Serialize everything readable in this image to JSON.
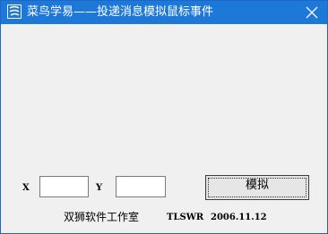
{
  "window": {
    "title": "菜鸟学易——投递消息模拟鼠标事件",
    "title_color": "#1e78d7",
    "icon": "app-logo-icon",
    "close_icon": "close-icon"
  },
  "form": {
    "x_label": "X",
    "y_label": "Y",
    "x_value": "",
    "y_value": "",
    "simulate_button": "模拟"
  },
  "footer": {
    "company": "双狮软件工作室",
    "code": "TLSWR",
    "date": "2006.11.12"
  }
}
